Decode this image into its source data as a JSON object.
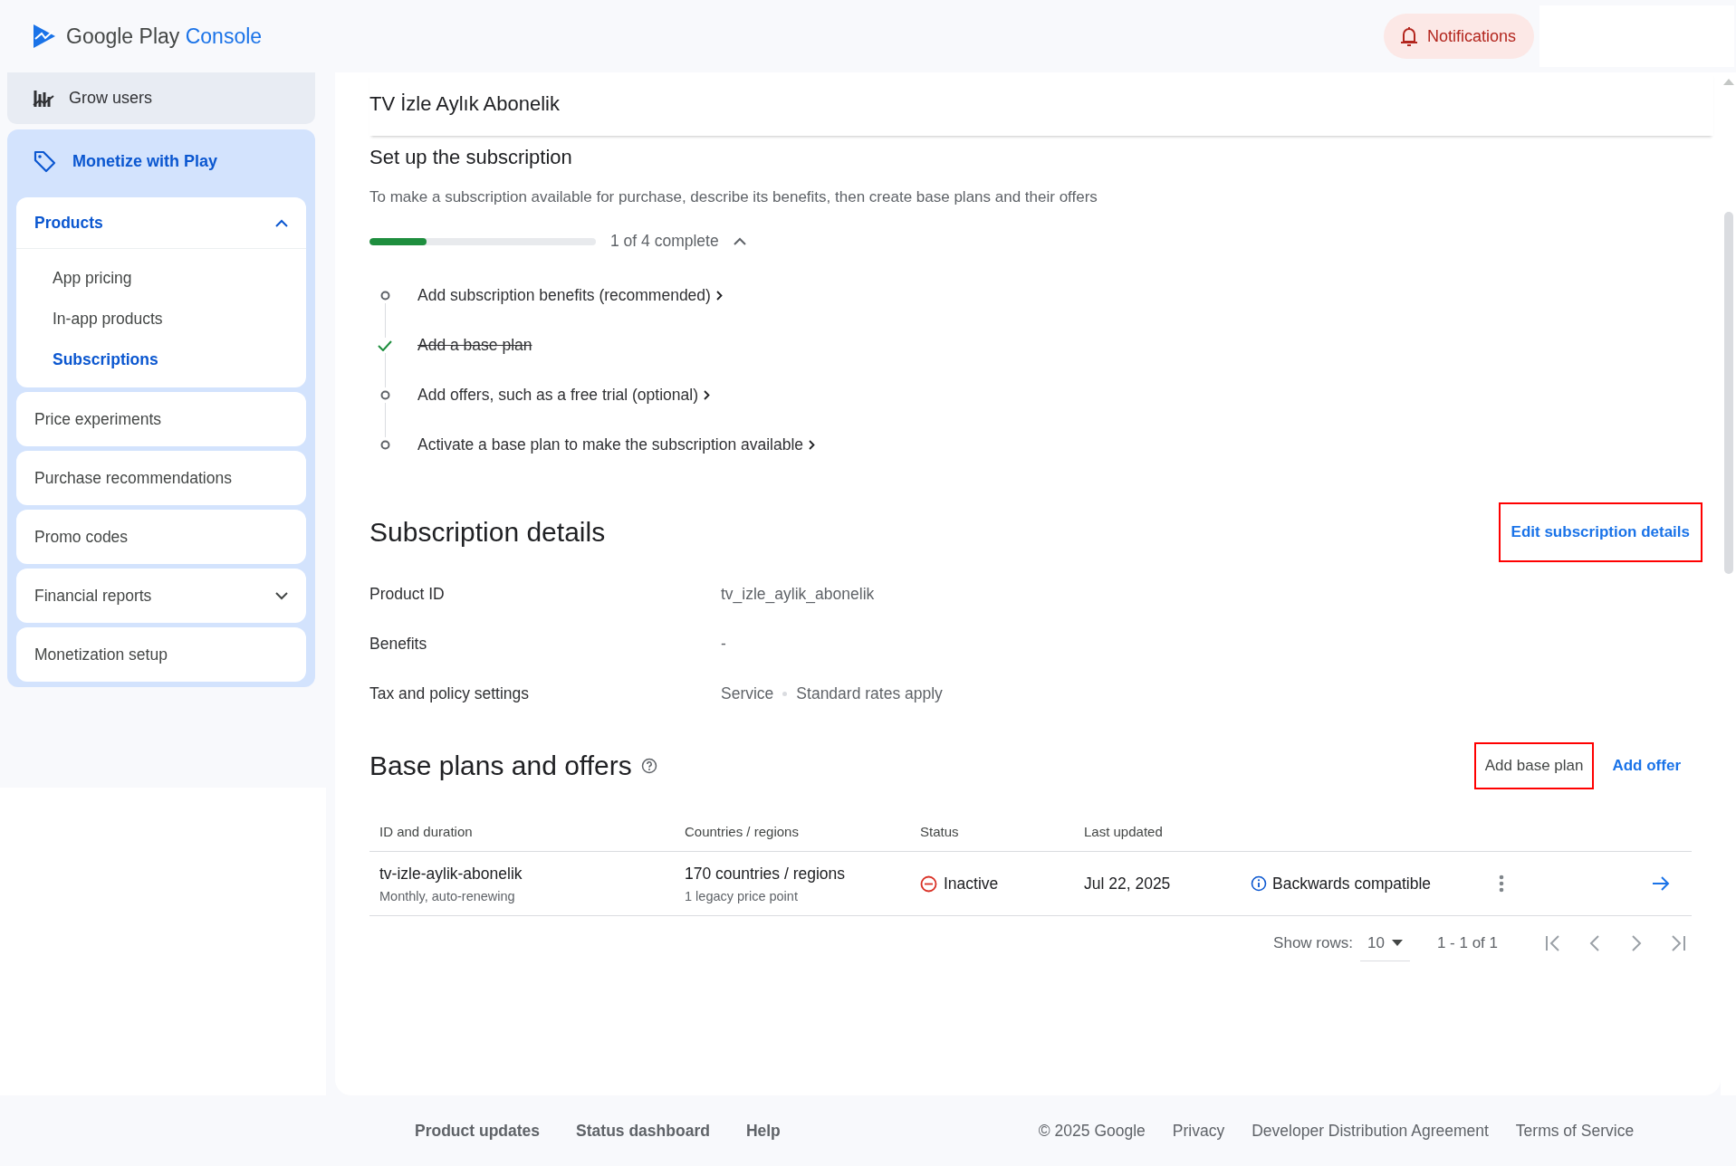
{
  "header": {
    "logo_brand": "Google Play",
    "logo_product": "Console",
    "notifications": "Notifications"
  },
  "sidebar": {
    "sections": [
      {
        "label": "Grow users",
        "selected": false
      },
      {
        "label": "Monetize with Play",
        "selected": true,
        "items": [
          {
            "label": "Products",
            "kind": "group",
            "expanded": true,
            "children": [
              {
                "label": "App pricing",
                "selected": false
              },
              {
                "label": "In-app products",
                "selected": false
              },
              {
                "label": "Subscriptions",
                "selected": true
              }
            ]
          },
          {
            "label": "Price experiments",
            "kind": "link"
          },
          {
            "label": "Purchase recommendations",
            "kind": "link"
          },
          {
            "label": "Promo codes",
            "kind": "link"
          },
          {
            "label": "Financial reports",
            "kind": "group",
            "expanded": false
          },
          {
            "label": "Monetization setup",
            "kind": "link"
          }
        ]
      }
    ]
  },
  "page_title": "TV İzle Aylık Abonelik",
  "setup": {
    "title": "Set up the subscription",
    "description": "To make a subscription available for purchase, describe its benefits, then create base plans and their offers",
    "progress": {
      "level": 0.25,
      "label": "1 of 4 complete",
      "expanded": true
    },
    "steps": [
      {
        "label": "Add subscription benefits (recommended)",
        "done": false
      },
      {
        "label": "Add a base plan",
        "done": true
      },
      {
        "label": "Add offers, such as a free trial (optional)",
        "done": false
      },
      {
        "label": "Activate a base plan to make the subscription available",
        "done": false
      }
    ]
  },
  "details": {
    "title": "Subscription details",
    "edit_button": {
      "label": "Edit subscription details",
      "highlighted": true
    },
    "fields": [
      {
        "label": "Product ID",
        "values": [
          "tv_izle_aylik_abonelik"
        ]
      },
      {
        "label": "Benefits",
        "values": [
          "-"
        ]
      },
      {
        "label": "Tax and policy settings",
        "values": [
          "Service",
          "Standard rates apply"
        ]
      }
    ]
  },
  "base_plans": {
    "title": "Base plans and offers",
    "buttons": [
      {
        "label": "Add base plan",
        "kind": "secondary",
        "highlighted": true
      },
      {
        "label": "Add offer",
        "kind": "primary",
        "highlighted": false
      }
    ],
    "table": {
      "columns": [
        "ID and duration",
        "Countries / regions",
        "Status",
        "Last updated"
      ],
      "rows": [
        {
          "id": "tv-izle-aylik-abonelik",
          "duration": "Monthly, auto-renewing",
          "countries": "170 countries / regions",
          "price_points": "1 legacy price point",
          "status": "Inactive",
          "active": false,
          "last_updated": "Jul 22, 2025",
          "note": "Backwards compatible"
        }
      ]
    },
    "pagination": {
      "show_rows_label": "Show rows:",
      "rows_value": "10",
      "range": "1 - 1 of 1"
    }
  },
  "footer": {
    "left_links": [
      "Product updates",
      "Status dashboard",
      "Help"
    ],
    "copyright": "© 2025 Google",
    "right_links": [
      "Privacy",
      "Developer Distribution Agreement",
      "Terms of Service"
    ]
  }
}
